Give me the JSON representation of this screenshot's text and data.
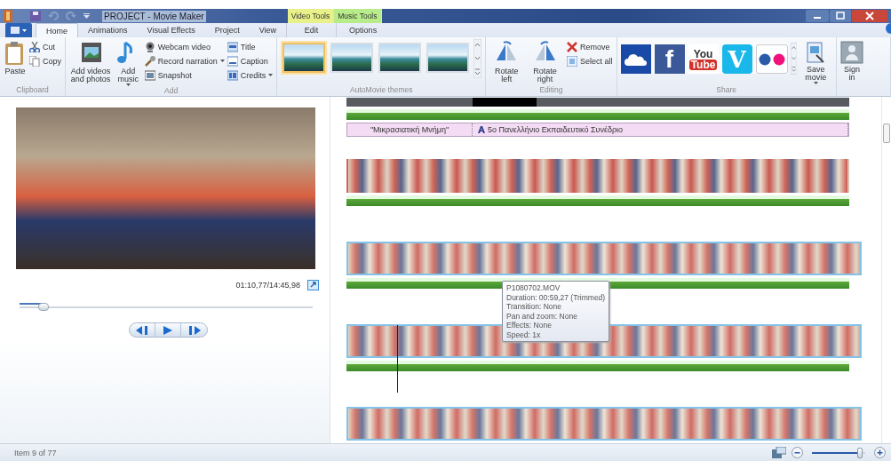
{
  "window": {
    "title": "PROJECT - Movie Maker"
  },
  "context_tabs": [
    {
      "header": "Video Tools",
      "label": "Edit",
      "color": "#e8f08a"
    },
    {
      "header": "Music Tools",
      "label": "Options",
      "color": "#b8ec8a"
    }
  ],
  "tabs": [
    {
      "label": "Home",
      "selected": true
    },
    {
      "label": "Animations",
      "selected": false
    },
    {
      "label": "Visual Effects",
      "selected": false
    },
    {
      "label": "Project",
      "selected": false
    },
    {
      "label": "View",
      "selected": false
    }
  ],
  "ribbon": {
    "clipboard": {
      "label": "Clipboard",
      "items": [
        {
          "kind": "large",
          "label": "Paste"
        },
        {
          "kind": "small",
          "label": "Cut"
        },
        {
          "kind": "small",
          "label": "Copy"
        }
      ]
    },
    "add": {
      "label": "Add",
      "items": [
        {
          "kind": "large",
          "label": "Add videos and photos",
          "dropdown": false
        },
        {
          "kind": "large",
          "label": "Add music",
          "dropdown": true
        },
        {
          "kind": "small",
          "label": "Webcam video",
          "dropdown": false
        },
        {
          "kind": "small",
          "label": "Record narration",
          "dropdown": true
        },
        {
          "kind": "small",
          "label": "Snapshot",
          "dropdown": false
        },
        {
          "kind": "small",
          "label": "Title",
          "dropdown": false
        },
        {
          "kind": "small",
          "label": "Caption",
          "dropdown": false
        },
        {
          "kind": "small",
          "label": "Credits",
          "dropdown": true
        }
      ]
    },
    "themes": {
      "label": "AutoMovie themes",
      "items": [
        {
          "selected": true
        },
        {
          "selected": false
        },
        {
          "selected": false
        },
        {
          "selected": false
        }
      ]
    },
    "editing": {
      "label": "Editing",
      "items": [
        {
          "kind": "large",
          "label": "Rotate left"
        },
        {
          "kind": "large",
          "label": "Rotate right"
        },
        {
          "kind": "small",
          "label": "Remove"
        },
        {
          "kind": "small",
          "label": "Select all"
        }
      ]
    },
    "share": {
      "label": "Share",
      "services": [
        {
          "kind": "cloud"
        },
        {
          "kind": "facebook",
          "text": "f"
        },
        {
          "kind": "youtube",
          "text": "You",
          "text_2": "Tube"
        },
        {
          "kind": "vimeo",
          "text": "V"
        },
        {
          "kind": "flickr"
        }
      ],
      "save": "Save movie"
    },
    "sign_in": "Sign in"
  },
  "player": {
    "time": "01:10,77/14:45,98",
    "seek": {
      "level": 0.08
    }
  },
  "storyboard": {
    "rows": [
      {
        "kind": "tail"
      },
      {
        "kind": "captions",
        "segments": [
          {
            "text": "\"Μικρασιατική Μνήμη\"",
            "title_mark": false
          },
          {
            "text": "5ο Πανελλήνιο Εκπαιδευτικό Συνέδριο",
            "title_mark": true
          }
        ]
      },
      {
        "kind": "clip",
        "selected": false
      },
      {
        "kind": "clip",
        "selected": true
      },
      {
        "kind": "clip",
        "selected": true
      },
      {
        "kind": "clip",
        "selected": true
      }
    ],
    "tooltip": [
      "P1080702.MOV",
      "Duration: 00:59,27 (Trimmed)",
      "Transition: None",
      "Pan and zoom: None",
      "Effects: None",
      "Speed: 1x"
    ]
  },
  "status_bar": {
    "text": "Item 9 of 77",
    "zoom": {
      "level": 0.9
    }
  }
}
